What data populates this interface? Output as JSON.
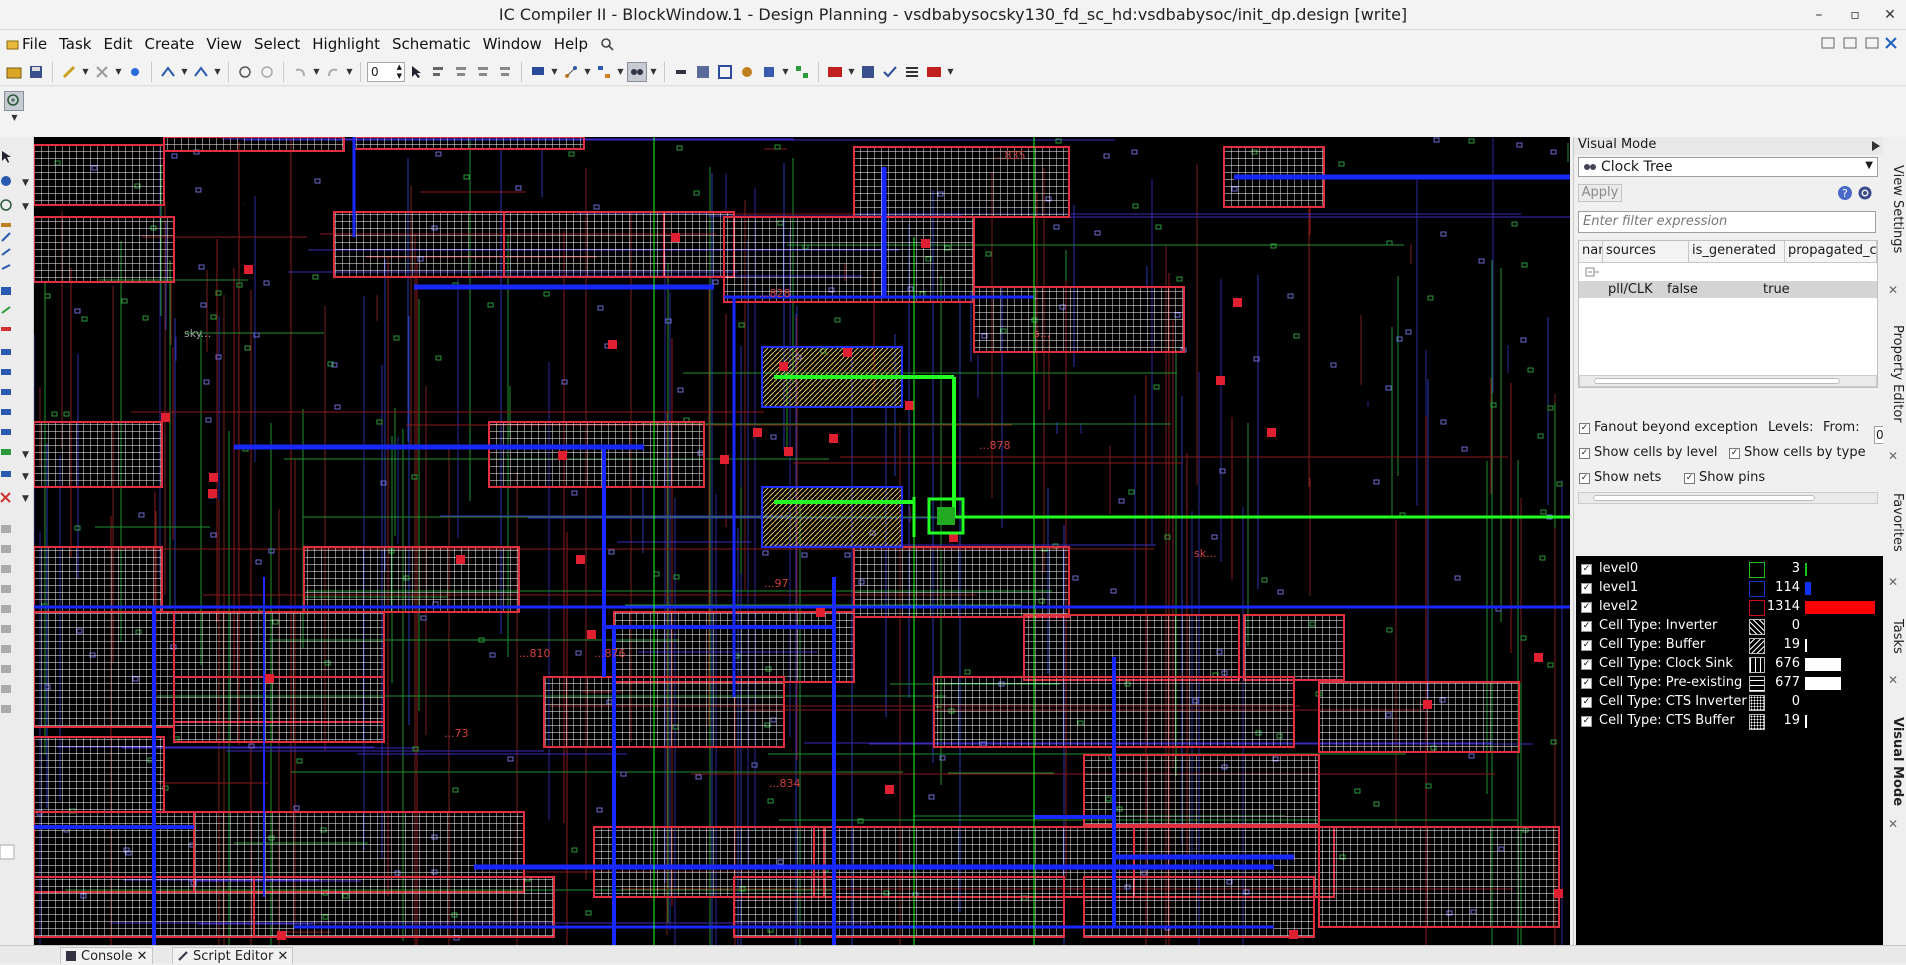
{
  "window": {
    "title": "IC Compiler II - BlockWindow.1 - Design Planning - vsdbabysocsky130_fd_sc_hd:vsdbabysoc/init_dp.design [write]",
    "controls": [
      "–",
      "▫",
      "✕"
    ]
  },
  "menubar": {
    "items": [
      "File",
      "Task",
      "Edit",
      "Create",
      "View",
      "Select",
      "Highlight",
      "Schematic",
      "Window",
      "Help"
    ]
  },
  "toolbar": {
    "level_value": "0"
  },
  "panel": {
    "title": "Visual Mode",
    "mode_select": "Clock Tree",
    "apply_label": "Apply",
    "filter_placeholder": "Enter filter expression",
    "columns": [
      "name",
      "sources",
      "is_generated",
      "propagated_clock"
    ],
    "rows": [
      {
        "sources": "pll/CLK",
        "is_generated": "false",
        "propagated_clock": "true"
      }
    ],
    "options": {
      "fanout": "Fanout beyond exception",
      "levels_label": "Levels:",
      "from_label": "From:",
      "from_value": "0",
      "show_cells_by_level": "Show cells by level",
      "show_cells_by_type": "Show cells by type",
      "show_nets": "Show nets",
      "show_pins": "Show pins"
    },
    "legend": [
      {
        "name": "level0",
        "count": "3",
        "swatch": "#1fbf1f",
        "bar": "#1fbf1f",
        "fraction": 0.0023,
        "pattern": "solid"
      },
      {
        "name": "level1",
        "count": "114",
        "swatch": "#1030c8",
        "bar": "#1030ff",
        "fraction": 0.087,
        "pattern": "solid"
      },
      {
        "name": "level2",
        "count": "1314",
        "swatch": "#c81010",
        "bar": "#ff0000",
        "fraction": 1.0,
        "pattern": "solid"
      },
      {
        "name": "Cell Type: Inverter",
        "count": "0",
        "swatch": "#ffffff",
        "bar": "#ffffff",
        "fraction": 0,
        "pattern": "backslash"
      },
      {
        "name": "Cell Type: Buffer",
        "count": "19",
        "swatch": "#ffffff",
        "bar": "#ffffff",
        "fraction": 0.014,
        "pattern": "slash"
      },
      {
        "name": "Cell Type: Clock Sink",
        "count": "676",
        "swatch": "#ffffff",
        "bar": "#ffffff",
        "fraction": 0.5145,
        "pattern": "vbars"
      },
      {
        "name": "Cell Type: Pre-existing",
        "count": "677",
        "swatch": "#ffffff",
        "bar": "#ffffff",
        "fraction": 0.5152,
        "pattern": "hbars"
      },
      {
        "name": "Cell Type: CTS Inverter",
        "count": "0",
        "swatch": "#ffffff",
        "bar": "#ffffff",
        "fraction": 0,
        "pattern": "dots"
      },
      {
        "name": "Cell Type: CTS Buffer",
        "count": "19",
        "swatch": "#ffffff",
        "bar": "#ffffff",
        "fraction": 0.014,
        "pattern": "dots"
      }
    ]
  },
  "side_tabs": [
    "View Settings",
    "Property Editor",
    "Favorites",
    "Tasks",
    "Visual Mode"
  ],
  "bottom_tabs": [
    "Console",
    "Script Editor"
  ],
  "canvas_labels": [
    "sky...",
    "s...",
    "sk...",
    "...835",
    "...828",
    "...878",
    "...810",
    "...876",
    "...834",
    "...73",
    "...97"
  ]
}
